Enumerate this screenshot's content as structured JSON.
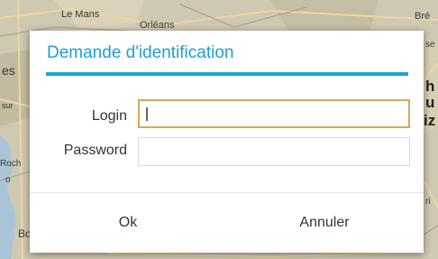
{
  "map": {
    "labels": [
      "Le Mans",
      "Orléans",
      "Bré",
      "es",
      "se",
      "sur",
      "h",
      "u",
      "iz",
      "Roch",
      "o",
      "Bo",
      "ri"
    ]
  },
  "dialog": {
    "title": "Demande d'identification",
    "login_label": "Login",
    "login_value": "",
    "password_label": "Password",
    "password_value": "",
    "ok_label": "Ok",
    "cancel_label": "Annuler",
    "accent_color": "#1e9ed6",
    "focus_color": "#d6a956"
  }
}
